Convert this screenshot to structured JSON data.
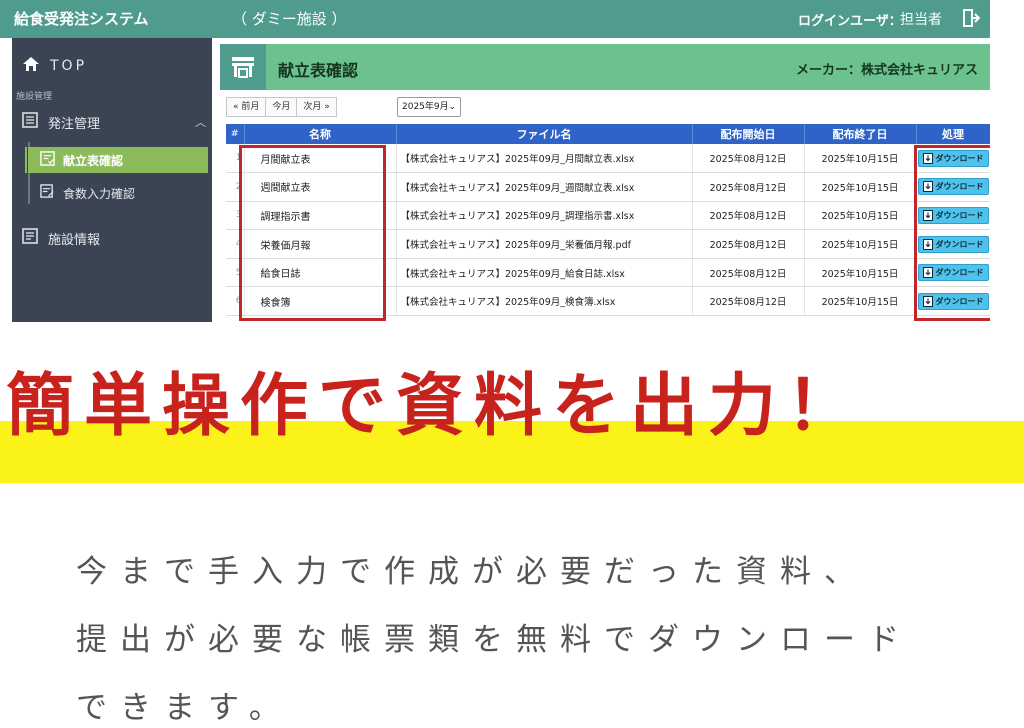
{
  "topbar": {
    "app_title": "給食受発注システム",
    "facility": "（ ダミー施設 ）",
    "login_label": "ログインユーザ：",
    "login_name": "担当者",
    "logout_icon": "logout-icon"
  },
  "sidebar": {
    "top_label": "TOP",
    "section_label": "施設管理",
    "order_label": "発注管理",
    "active_item": "献立表確認",
    "sub_item": "食数入力確認",
    "info_label": "施設情報"
  },
  "page": {
    "title": "献立表確認",
    "maker": "メーカー：株式会社キュリアス",
    "prev_month": "« 前月",
    "this_month": "今月",
    "next_month": "次月 »",
    "month_value": "2025年9月"
  },
  "table": {
    "headers": [
      "#",
      "名称",
      "ファイル名",
      "配布開始日",
      "配布終了日",
      "処理"
    ],
    "download_label": "ダウンロード",
    "rows": [
      {
        "num": "1",
        "name": "月間献立表",
        "file": "【株式会社キュリアス】2025年09月_月間献立表.xlsx",
        "start": "2025年08月12日",
        "end": "2025年10月15日"
      },
      {
        "num": "2",
        "name": "週間献立表",
        "file": "【株式会社キュリアス】2025年09月_週間献立表.xlsx",
        "start": "2025年08月12日",
        "end": "2025年10月15日"
      },
      {
        "num": "3",
        "name": "調理指示書",
        "file": "【株式会社キュリアス】2025年09月_調理指示書.xlsx",
        "start": "2025年08月12日",
        "end": "2025年10月15日"
      },
      {
        "num": "4",
        "name": "栄養価月報",
        "file": "【株式会社キュリアス】2025年09月_栄養価月報.pdf",
        "start": "2025年08月12日",
        "end": "2025年10月15日"
      },
      {
        "num": "5",
        "name": "給食日誌",
        "file": "【株式会社キュリアス】2025年09月_給食日誌.xlsx",
        "start": "2025年08月12日",
        "end": "2025年10月15日"
      },
      {
        "num": "6",
        "name": "検食簿",
        "file": "【株式会社キュリアス】2025年09月_検食簿.xlsx",
        "start": "2025年08月12日",
        "end": "2025年10月15日"
      }
    ]
  },
  "headline": "簡単操作で資料を出力！",
  "description": [
    "今まで手入力で作成が必要だった資料、",
    "提出が必要な帳票類を無料でダウンロード",
    "できます。"
  ],
  "colors": {
    "topbar": "#4f9b8d",
    "sidebar": "#3b4452",
    "active_item": "#8cbb5b",
    "page_header": "#6cc28f",
    "table_header": "#2f63c7",
    "download_button": "#4fc2ec",
    "highlight_box": "#c0272d",
    "headline_text": "#c8221d",
    "headline_band": "#fbf21a"
  }
}
